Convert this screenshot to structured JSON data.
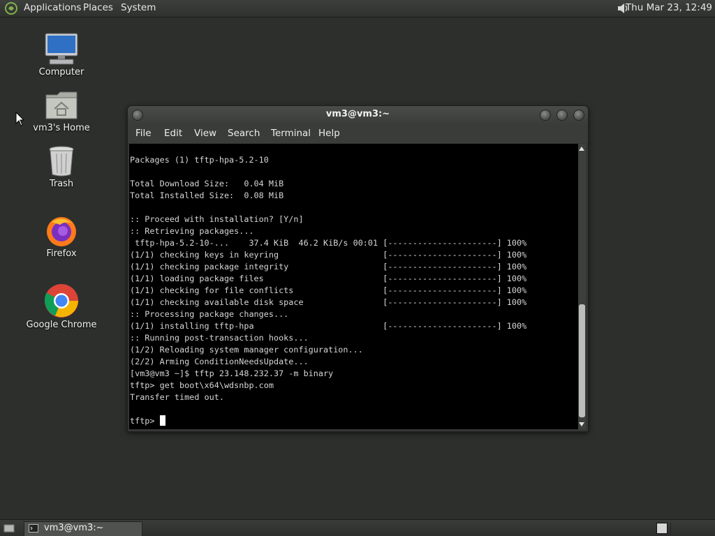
{
  "top_panel": {
    "menus": [
      "Applications",
      "Places",
      "System"
    ],
    "clock": "Thu Mar 23, 12:49",
    "volume_icon": "speaker-icon"
  },
  "desktop_icons": [
    {
      "label": "Computer",
      "icon": "computer-icon"
    },
    {
      "label": "vm3's Home",
      "icon": "home-folder-icon"
    },
    {
      "label": "Trash",
      "icon": "trash-icon"
    },
    {
      "label": "Firefox",
      "icon": "firefox-icon"
    },
    {
      "label": "Google Chrome",
      "icon": "chrome-icon"
    }
  ],
  "terminal": {
    "title": "vm3@vm3:~",
    "menu": [
      "File",
      "Edit",
      "View",
      "Search",
      "Terminal",
      "Help"
    ],
    "lines": [
      "Packages (1) tftp-hpa-5.2-10",
      "",
      "Total Download Size:   0.04 MiB",
      "Total Installed Size:  0.08 MiB",
      "",
      ":: Proceed with installation? [Y/n]",
      ":: Retrieving packages...",
      " tftp-hpa-5.2-10-...    37.4 KiB  46.2 KiB/s 00:01 [----------------------] 100%",
      "(1/1) checking keys in keyring                     [----------------------] 100%",
      "(1/1) checking package integrity                   [----------------------] 100%",
      "(1/1) loading package files                        [----------------------] 100%",
      "(1/1) checking for file conflicts                  [----------------------] 100%",
      "(1/1) checking available disk space                [----------------------] 100%",
      ":: Processing package changes...",
      "(1/1) installing tftp-hpa                          [----------------------] 100%",
      ":: Running post-transaction hooks...",
      "(1/2) Reloading system manager configuration...",
      "(2/2) Arming ConditionNeedsUpdate...",
      "[vm3@vm3 ~]$ tftp 23.148.232.37 -m binary",
      "tftp> get boot\\x64\\wdsnbp.com",
      "Transfer timed out.",
      ""
    ],
    "prompt": "tftp> "
  },
  "taskbar": {
    "window_button": "vm3@vm3:~"
  }
}
